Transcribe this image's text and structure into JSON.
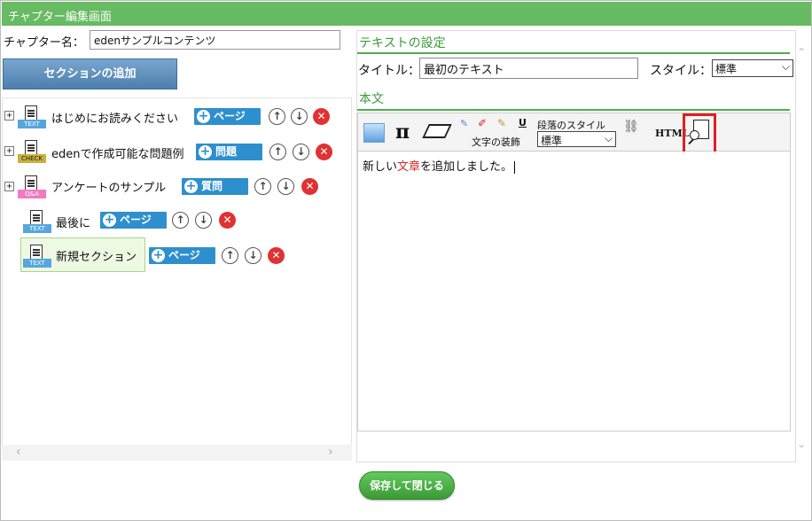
{
  "window": {
    "title": "チャプター編集画面"
  },
  "chapter": {
    "label": "チャプター名：",
    "value": "edenサンプルコンテンツ"
  },
  "add_section_label": "セクションの追加",
  "tree": [
    {
      "label": "はじめにお読みください",
      "tag": "TEXT",
      "button": "ページ"
    },
    {
      "label": "edenで作成可能な問題例",
      "tag": "CHECK",
      "button": "問題"
    },
    {
      "label": "アンケートのサンプル",
      "tag": "Q&A",
      "button": "質問"
    },
    {
      "label": "最後に",
      "tag": "TEXT",
      "button": "ページ"
    },
    {
      "label": "新規セクション",
      "tag": "TEXT",
      "button": "ページ"
    }
  ],
  "text_settings": {
    "heading": "テキストの設定",
    "title_label": "タイトル：",
    "title_value": "最初のテキスト",
    "style_label": "スタイル：",
    "style_value": "標準"
  },
  "body": {
    "heading": "本文",
    "toolbar": {
      "pi": "π",
      "underline": "U",
      "decoration_label": "文字の装飾",
      "paragraph_label": "段落のスタイル",
      "paragraph_value": "標準",
      "html_label": "HTML"
    },
    "text_before": "新しい",
    "text_red": "文章",
    "text_after": "を追加しました。"
  },
  "save_label": "保存して閉じる"
}
